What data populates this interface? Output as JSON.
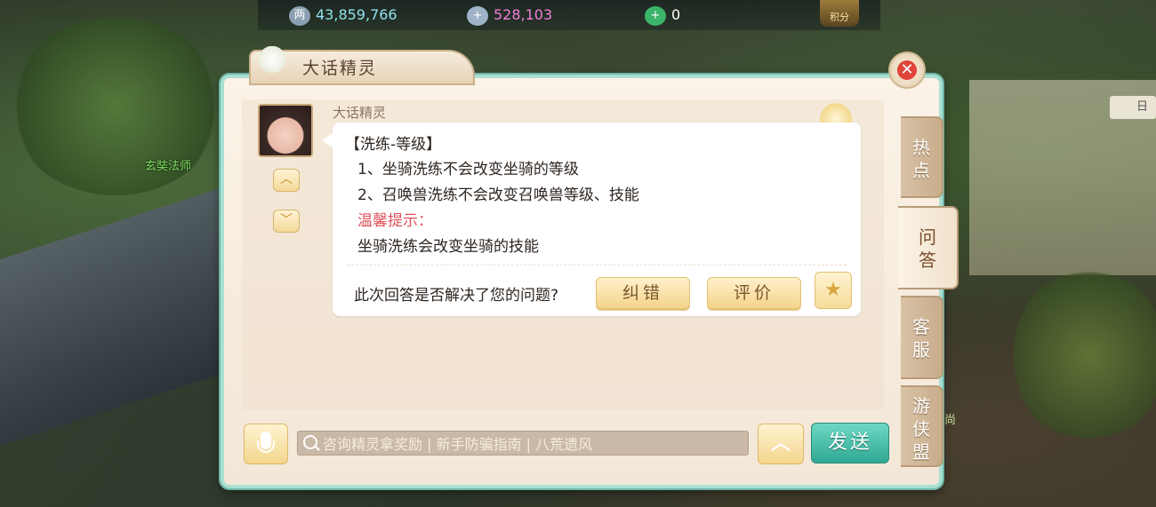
{
  "topbar": {
    "silver": {
      "icon": "silver-coin-icon",
      "value": "43,859,766"
    },
    "ingot": {
      "icon": "silver-ingot-icon",
      "value": "528,103"
    },
    "jade": {
      "icon": "jade-icon",
      "value": "0"
    },
    "score_label": "积分"
  },
  "scene": {
    "npc_name": "玄奘法师",
    "side_name": "尚",
    "side_sign": "日"
  },
  "dialog": {
    "title": "大话精灵",
    "speaker": "大话精灵",
    "badge": "游侠盟",
    "message": {
      "heading": "【洗练-等级】",
      "items": [
        "1、坐骑洗练不会改变坐骑的等级",
        "2、召唤兽洗练不会改变召唤兽等级、技能"
      ],
      "tip_label": "温馨提示：",
      "tip_text": "坐骑洗练会改变坐骑的技能"
    },
    "feedback": {
      "question": "此次回答是否解决了您的问题?",
      "correct_label": "纠错",
      "rate_label": "评价"
    },
    "tabs": [
      {
        "label": "热点"
      },
      {
        "label": "问答",
        "active": true
      },
      {
        "label": "客服"
      },
      {
        "label": "游侠盟"
      }
    ],
    "input": {
      "placeholder": "咨询精灵拿奖励 | 新手防骗指南 | 八荒遗风"
    },
    "send_label": "发送"
  }
}
